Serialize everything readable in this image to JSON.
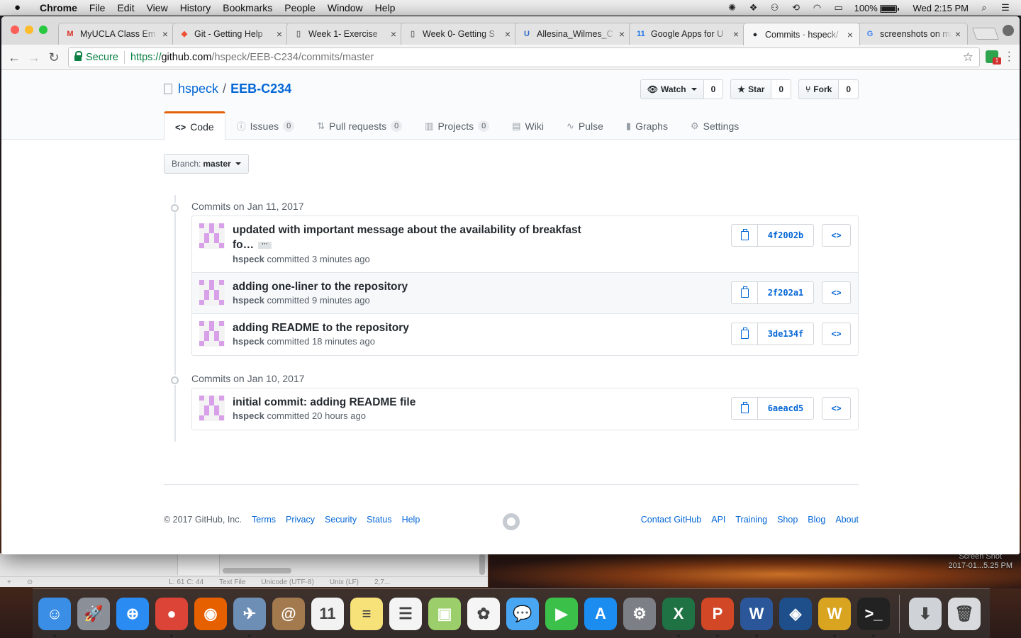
{
  "menubar": {
    "app": "Chrome",
    "items": [
      "File",
      "Edit",
      "View",
      "History",
      "Bookmarks",
      "People",
      "Window",
      "Help"
    ],
    "battery": "100%",
    "clock": "Wed 2:15 PM"
  },
  "tabs": [
    {
      "title": "MyUCLA Class Em",
      "icon": "gmail-icon",
      "color": "#d93025"
    },
    {
      "title": "Git - Getting Help",
      "icon": "git-icon",
      "color": "#f05033"
    },
    {
      "title": "Week 1- Exercise",
      "icon": "document-icon",
      "color": "#777777"
    },
    {
      "title": "Week 0- Getting S",
      "icon": "document-icon",
      "color": "#777777"
    },
    {
      "title": "Allesina_Wilmes_C",
      "icon": "ucla-icon",
      "color": "#2d68c4"
    },
    {
      "title": "Google Apps for U",
      "icon": "calendar-icon",
      "color": "#1a73e8"
    },
    {
      "title": "Commits · hspeck/",
      "icon": "github-icon",
      "color": "#24292e"
    },
    {
      "title": "screenshots on ma",
      "icon": "google-icon",
      "color": "#4285f4"
    }
  ],
  "address": {
    "secure_label": "Secure",
    "scheme": "https://",
    "host": "github.com",
    "path": "/hspeck/EEB-C234/commits/master"
  },
  "repo": {
    "owner": "hspeck",
    "name": "EEB-C234",
    "watch_label": "Watch",
    "watch_count": "0",
    "star_label": "Star",
    "star_count": "0",
    "fork_label": "Fork",
    "fork_count": "0"
  },
  "reponav": [
    {
      "label": "Code",
      "icon": "code-icon",
      "counter": null,
      "selected": true
    },
    {
      "label": "Issues",
      "icon": "issue-icon",
      "counter": "0"
    },
    {
      "label": "Pull requests",
      "icon": "pull-request-icon",
      "counter": "0"
    },
    {
      "label": "Projects",
      "icon": "project-icon",
      "counter": "0"
    },
    {
      "label": "Wiki",
      "icon": "book-icon",
      "counter": null
    },
    {
      "label": "Pulse",
      "icon": "pulse-icon",
      "counter": null
    },
    {
      "label": "Graphs",
      "icon": "graph-icon",
      "counter": null
    },
    {
      "label": "Settings",
      "icon": "gear-icon",
      "counter": null
    }
  ],
  "branch": {
    "prefix": "Branch:",
    "name": "master"
  },
  "commit_groups": [
    {
      "title": "Commits on Jan 11, 2017",
      "commits": [
        {
          "message_line1": "updated with important message about the availability of breakfast",
          "message_line2": "fo…",
          "author": "hspeck",
          "verb": "committed",
          "time": "3 minutes ago",
          "sha": "4f2002b"
        },
        {
          "message_line1": "adding one-liner to the repository",
          "author": "hspeck",
          "verb": "committed",
          "time": "9 minutes ago",
          "sha": "2f202a1"
        },
        {
          "message_line1": "adding README to the repository",
          "author": "hspeck",
          "verb": "committed",
          "time": "18 minutes ago",
          "sha": "3de134f"
        }
      ]
    },
    {
      "title": "Commits on Jan 10, 2017",
      "commits": [
        {
          "message_line1": "initial commit: adding README file",
          "author": "hspeck",
          "verb": "committed",
          "time": "20 hours ago",
          "sha": "6aeacd5"
        }
      ]
    }
  ],
  "footer": {
    "copyright": "© 2017 GitHub, Inc.",
    "left_links": [
      "Terms",
      "Privacy",
      "Security",
      "Status",
      "Help"
    ],
    "right_links": [
      "Contact GitHub",
      "API",
      "Training",
      "Shop",
      "Blog",
      "About"
    ]
  },
  "editor_status": {
    "position": "L: 61 C: 44",
    "mode": "Text File",
    "encoding": "Unicode (UTF-8)",
    "line_endings": "Unix (LF)",
    "size": "2,7..."
  },
  "desktop_file": {
    "line1": "Screen Shot",
    "line2": "2017-01...5.25 PM"
  },
  "dock": [
    {
      "name": "finder-icon",
      "color": "#3a8ee6",
      "glyph": "☺"
    },
    {
      "name": "launchpad-icon",
      "color": "#8a8f98",
      "glyph": "🚀"
    },
    {
      "name": "safari-icon",
      "color": "#2a8bf2",
      "glyph": "⊕"
    },
    {
      "name": "chrome-icon",
      "color": "#db4437",
      "glyph": "●"
    },
    {
      "name": "firefox-icon",
      "color": "#e66000",
      "glyph": "◉"
    },
    {
      "name": "preview-icon",
      "color": "#6e8fb5",
      "glyph": "✈"
    },
    {
      "name": "contacts-icon",
      "color": "#a27a4e",
      "glyph": "@"
    },
    {
      "name": "calendar-icon",
      "color": "#f2f2f2",
      "glyph": "11"
    },
    {
      "name": "notes-icon",
      "color": "#f7e27a",
      "glyph": "≡"
    },
    {
      "name": "reminders-icon",
      "color": "#f4f4f4",
      "glyph": "☰"
    },
    {
      "name": "photo-booth-icon",
      "color": "#9ccf6b",
      "glyph": "▣"
    },
    {
      "name": "photos-icon",
      "color": "#f5f5f5",
      "glyph": "✿"
    },
    {
      "name": "messages-icon",
      "color": "#48a6f2",
      "glyph": "💬"
    },
    {
      "name": "facetime-icon",
      "color": "#3bc14a",
      "glyph": "▶"
    },
    {
      "name": "app-store-icon",
      "color": "#1b8df1",
      "glyph": "A"
    },
    {
      "name": "system-preferences-icon",
      "color": "#7c7f86",
      "glyph": "⚙"
    },
    {
      "name": "excel-icon",
      "color": "#1f7244",
      "glyph": "X"
    },
    {
      "name": "powerpoint-icon",
      "color": "#d24726",
      "glyph": "P"
    },
    {
      "name": "word-icon",
      "color": "#2b579a",
      "glyph": "W"
    },
    {
      "name": "virtualbox-icon",
      "color": "#1f4f8b",
      "glyph": "◈"
    },
    {
      "name": "textwrangler-icon",
      "color": "#d9a520",
      "glyph": "W"
    },
    {
      "name": "terminal-icon",
      "color": "#222222",
      "glyph": ">_"
    },
    {
      "name": "downloads-icon",
      "color": "#cfd3d8",
      "glyph": "⬇"
    },
    {
      "name": "trash-icon",
      "color": "#d8dadd",
      "glyph": "🗑"
    }
  ]
}
